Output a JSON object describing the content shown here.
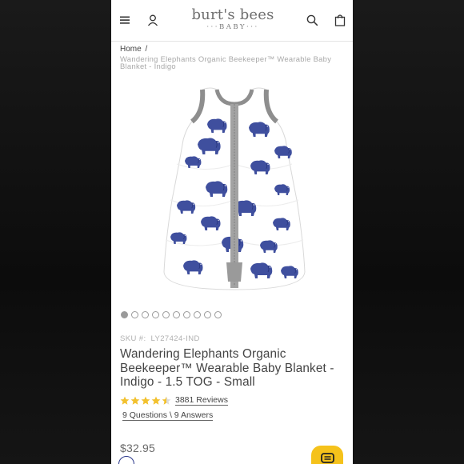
{
  "brand": {
    "name": "burt's bees",
    "sub": "BABY"
  },
  "header": {
    "icons": [
      "menu-icon",
      "account-icon",
      "search-icon",
      "bag-icon"
    ]
  },
  "breadcrumb": {
    "home": "Home",
    "separator": "/",
    "current": "Wandering Elephants Organic Beekeeper™ Wearable Baby Blanket - Indigo"
  },
  "carousel": {
    "total": 10,
    "active_index": 0
  },
  "product": {
    "sku_label": "SKU #:",
    "sku": "LY27424-IND",
    "title": "Wandering Elephants Organic Beekeeper™ Wearable Baby Blanket - Indigo - 1.5 TOG - Small",
    "rating": 4.5,
    "reviews": "3881 Reviews",
    "qa": "9 Questions \\ 9 Answers",
    "price": "$32.95"
  },
  "colors": {
    "star": "#f2c12e",
    "chat_button": "#f5c21b",
    "elephant": "#3f4f9e",
    "trim": "#8e8e8e"
  }
}
